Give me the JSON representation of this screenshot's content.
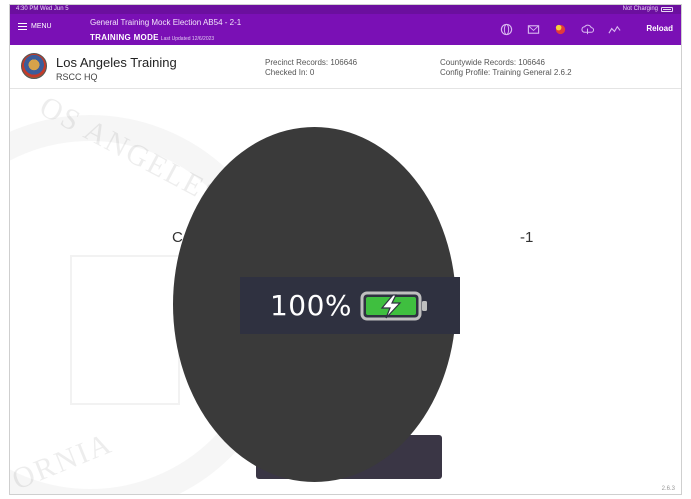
{
  "status_bar": {
    "left_text": "4:30 PM  Wed Jun 5",
    "right_text": "Not Charging"
  },
  "header": {
    "menu_label": "MENU",
    "election_title": "General Training Mock Election AB54 - 2-1",
    "mode_label": "TRAINING MODE",
    "mode_sub": "Last Updated 12/6/2023",
    "icons": [
      "globe-icon",
      "mail-icon",
      "notification-icon",
      "upload-icon",
      "signal-icon"
    ],
    "reload_label": "Reload"
  },
  "site": {
    "name": "Los Angeles Training",
    "code": "RSCC HQ"
  },
  "stats": {
    "precinct_records": "Precinct Records: 106646",
    "checked_in": "Checked In: 0",
    "countywide_records": "Countywide Records: 106646",
    "config_profile": "Config Profile: Training General 2.6.2"
  },
  "main": {
    "left_fragment": "C",
    "right_fragment": "-1"
  },
  "battery_overlay": {
    "percent_text": "100%",
    "charging": true,
    "level": 1.0,
    "fill_color": "#3fbf3f"
  },
  "watermark": {
    "top_text": "OS ANGELES",
    "bottom_text": "ORNIA"
  },
  "footer": {
    "version": "2.6.3"
  },
  "colors": {
    "brand_purple": "#7a10b5",
    "overlay_dark": "#3a3a3a",
    "pill_dark": "#2f3140"
  }
}
